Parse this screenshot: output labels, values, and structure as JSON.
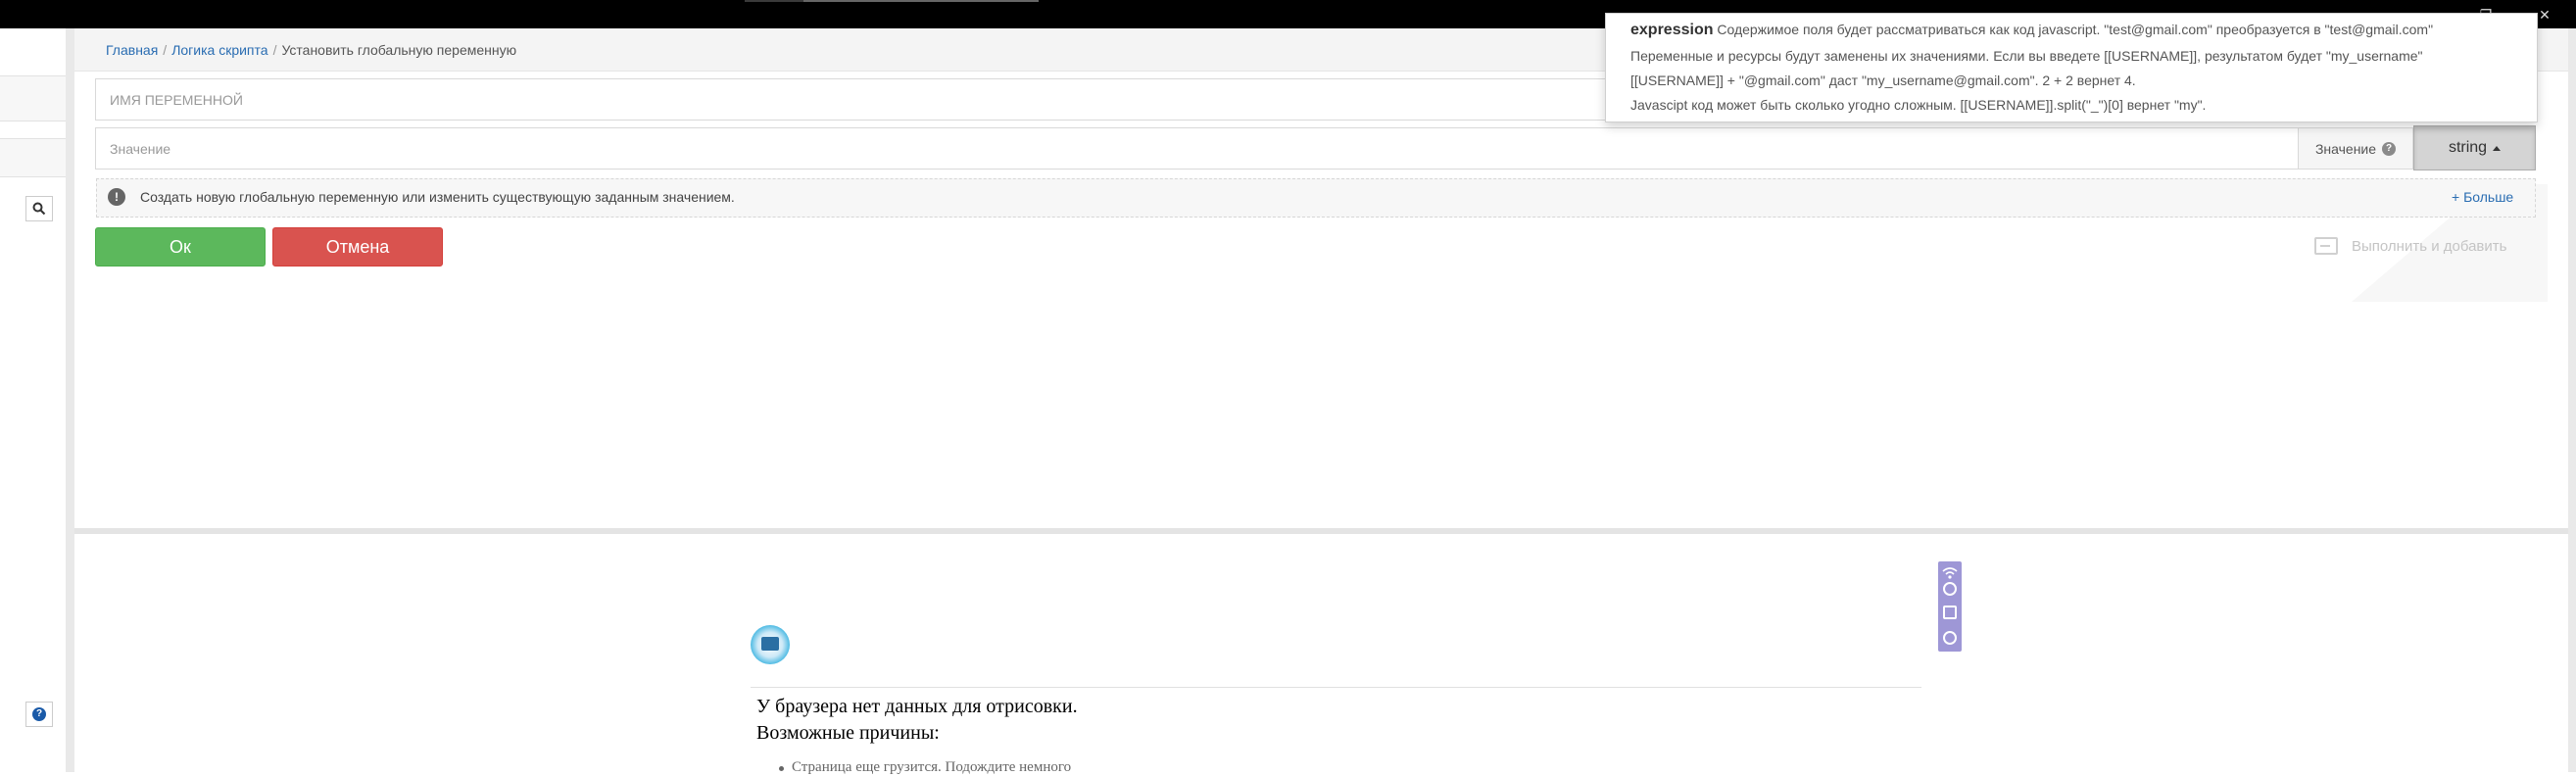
{
  "window": {
    "minimize_glyph": "—",
    "restore_glyph": "❐",
    "close_glyph": "✕"
  },
  "breadcrumb": {
    "items": [
      "Главная",
      "Логика скрипта",
      "Установить глобальную переменную"
    ],
    "separator": "/"
  },
  "form": {
    "variable_name_placeholder": "ИМЯ ПЕРЕМЕННОЙ",
    "value_placeholder": "Значение",
    "value_addon_label": "Значение",
    "type_button_label": "string"
  },
  "info": {
    "text": "Создать новую глобальную переменную или изменить существующую заданным значением.",
    "more_link": "+ Больше"
  },
  "actions": {
    "ok_label": "Ок",
    "cancel_label": "Отмена",
    "execute_add_label": "Выполнить и добавить"
  },
  "tooltip": {
    "keyword": "expression",
    "line1_rest": "Содержимое поля будет рассматриваться как код javascript. \"test@gmail.com\" преобразуется в \"test@gmail.com\"",
    "line2": "Переменные и ресурсы будут заменены их значениями. Если вы введете [[USERNAME]], результатом будет \"my_username\"",
    "line3": "[[USERNAME]] + \"@gmail.com\" даст \"my_username@gmail.com\". 2 + 2 вернет 4.",
    "line4": "Javascipt код может быть сколько угодно сложным. [[USERNAME]].split(\"_\")[0] вернет \"my\"."
  },
  "browser_panel": {
    "no_data_message": "У браузера нет данных для отрисовки.",
    "possible_reasons": "Возможные причины:",
    "reason1": "Страница еще грузится. Подождите немного"
  },
  "colors": {
    "ok": "#5cb85c",
    "cancel": "#d9534f",
    "link": "#2a6db2",
    "mini_toolbar": "#9e97d6"
  }
}
